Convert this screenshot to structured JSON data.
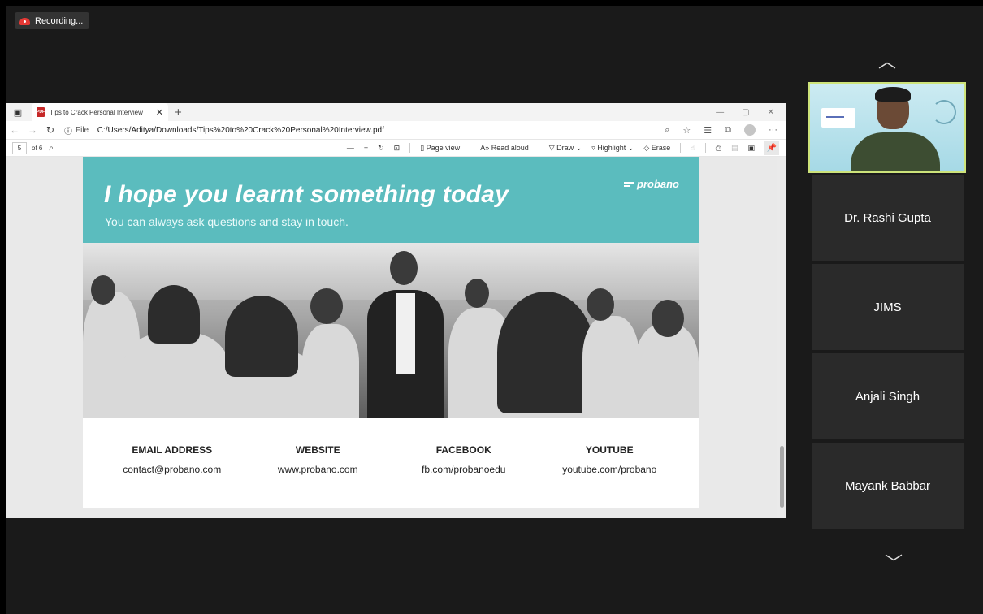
{
  "recording": {
    "label": "Recording..."
  },
  "browser": {
    "tab_title": "Tips to Crack Personal Interview",
    "url_prefix": "File",
    "url": "C:/Users/Aditya/Downloads/Tips%20to%20Crack%20Personal%20Interview.pdf",
    "pdf_toolbar": {
      "page_current": "5",
      "page_total": "of 6",
      "page_view": "Page view",
      "read_aloud": "Read aloud",
      "draw": "Draw",
      "highlight": "Highlight",
      "erase": "Erase"
    }
  },
  "slide": {
    "title": "I hope you learnt something today",
    "subtitle": "You can always ask questions and stay in touch.",
    "logo_text": "probano",
    "contacts": [
      {
        "label": "EMAIL ADDRESS",
        "value": "contact@probano.com"
      },
      {
        "label": "WEBSITE",
        "value": "www.probano.com"
      },
      {
        "label": "FACEBOOK",
        "value": "fb.com/probanoedu"
      },
      {
        "label": "YOUTUBE",
        "value": "youtube.com/probano"
      }
    ]
  },
  "participants": [
    {
      "name": "Dr. Rashi Gupta"
    },
    {
      "name": "JIMS"
    },
    {
      "name": "Anjali Singh"
    },
    {
      "name": "Mayank Babbar"
    }
  ],
  "colors": {
    "banner": "#5bbcbe",
    "self_view_border": "#cde37a",
    "record_dot": "#e53935"
  }
}
